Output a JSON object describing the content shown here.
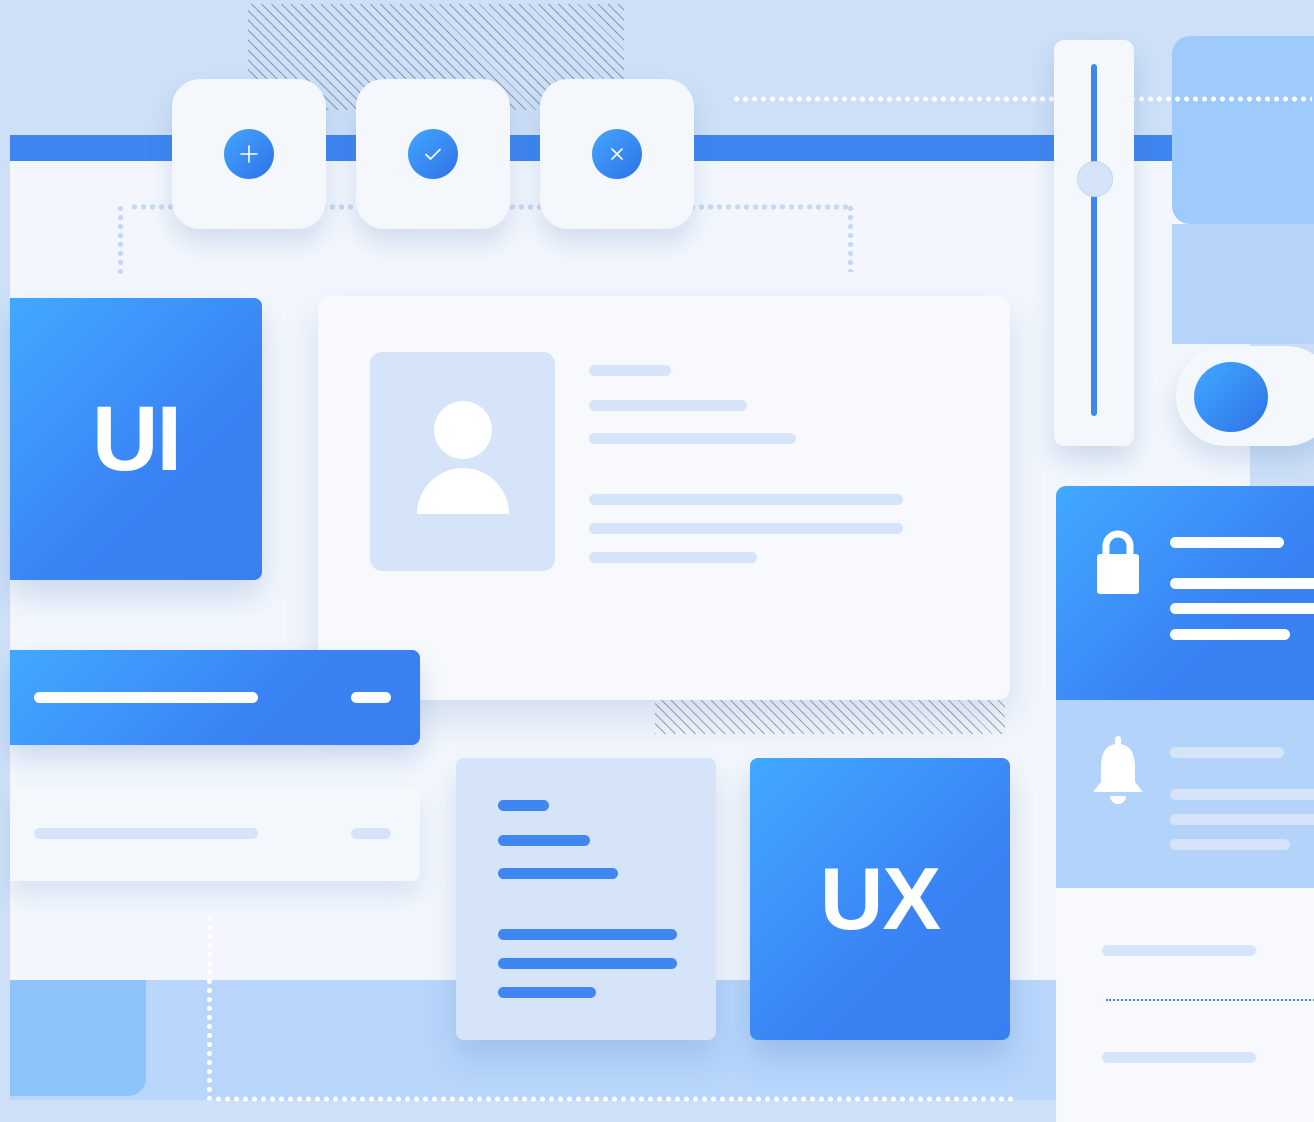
{
  "colors": {
    "background": "#cde0f7",
    "primary": "#3f86f0",
    "primary_light": "#41a9ff",
    "card": "#f4f7fc",
    "placeholder": "#d5e4f8"
  },
  "toolbar": {
    "buttons": [
      {
        "icon": "plus-icon",
        "glyph": "+"
      },
      {
        "icon": "check-icon",
        "glyph": "✓"
      },
      {
        "icon": "close-icon",
        "glyph": "×"
      }
    ]
  },
  "tiles": {
    "ui_label": "UI",
    "ux_label": "UX"
  },
  "profile_card": {
    "avatar_icon": "user-icon"
  },
  "slider": {
    "level": 0.67,
    "orientation": "vertical"
  },
  "toggle": {
    "state": "off"
  },
  "notifications": {
    "items": [
      {
        "icon": "lock-icon",
        "style": "active"
      },
      {
        "icon": "bell-icon",
        "style": "muted"
      }
    ]
  }
}
